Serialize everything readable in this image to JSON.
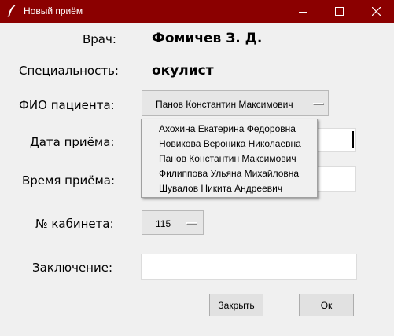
{
  "window": {
    "title": "Новый приём",
    "accent": "#8b0000"
  },
  "form": {
    "doctor_label": "Врач:",
    "doctor_value": "Фомичев З. Д.",
    "specialty_label": "Специальность:",
    "specialty_value": "окулист",
    "patient_label": "ФИО пациента:",
    "patient_selected": "Панов Константин Максимович",
    "date_label": "Дата приёма:",
    "date_value": "",
    "time_label": "Время приёма:",
    "time_value": "",
    "cabinet_label": "№ кабинета:",
    "cabinet_selected": "115",
    "conclusion_label": "Заключение:",
    "conclusion_value": ""
  },
  "patient_dropdown": {
    "items": [
      "Ахохина Екатерина Федоровна",
      "Новикова Вероника Николаевна",
      "Панов Константин Максимович",
      "Филиппова Ульяна Михайловна",
      "Шувалов Никита Андреевич"
    ]
  },
  "buttons": {
    "close": "Закрыть",
    "ok": "Ок"
  }
}
